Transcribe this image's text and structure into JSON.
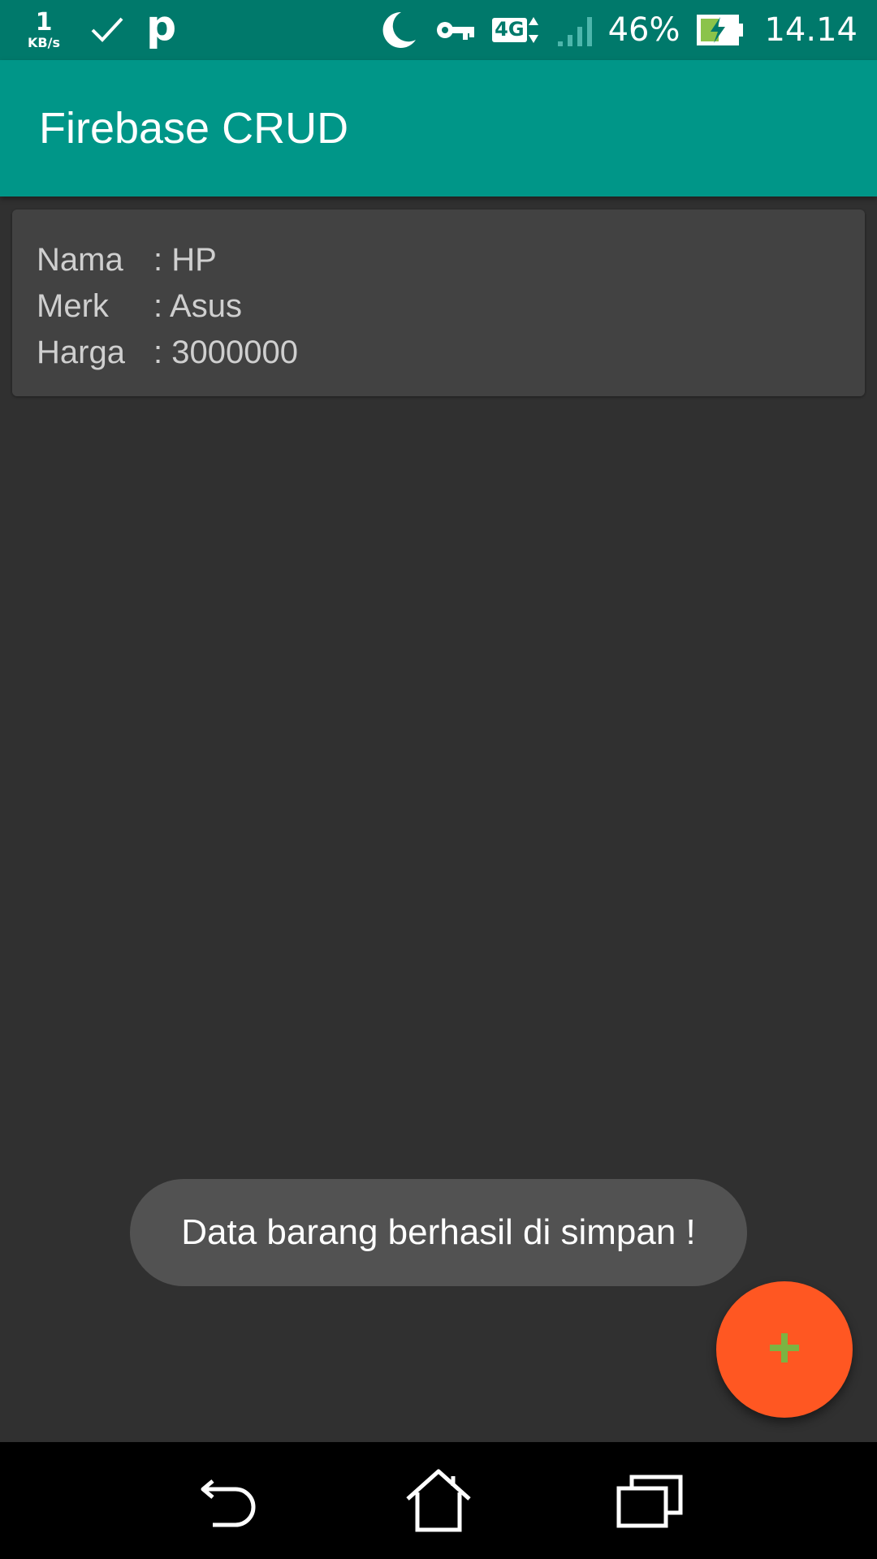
{
  "status_bar": {
    "net_speed_value": "1",
    "net_speed_unit": "KB/s",
    "notification_letter": "p",
    "network_type": "4G",
    "battery_percent": "46%",
    "time": "14.14",
    "icons": [
      "check-icon",
      "moon-icon",
      "key-icon",
      "signal-icon",
      "battery-charging-icon"
    ]
  },
  "app_bar": {
    "title": "Firebase CRUD"
  },
  "item": {
    "fields": [
      {
        "label": "Nama",
        "value": ": HP"
      },
      {
        "label": "Merk",
        "value": ": Asus"
      },
      {
        "label": "Harga",
        "value": ": 3000000"
      }
    ]
  },
  "toast": {
    "message": "Data barang berhasil di simpan !"
  },
  "fab": {
    "icon": "plus-icon",
    "color": "#ff5722",
    "icon_color": "#7cb342"
  },
  "colors": {
    "primary": "#009688",
    "primary_dark": "#00796b",
    "background": "#303030",
    "card": "#424242"
  },
  "nav_bar": {
    "icons": [
      "back-icon",
      "home-icon",
      "recents-icon"
    ]
  }
}
